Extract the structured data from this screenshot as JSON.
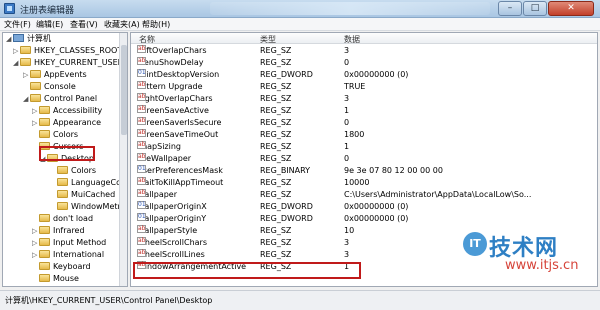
{
  "window": {
    "title": "注册表编辑器",
    "controls": {
      "minimize": "–",
      "maximize": "□",
      "close": "✕"
    }
  },
  "menubar": [
    "文件(F)",
    "编辑(E)",
    "查看(V)",
    "收藏夹(A)",
    "帮助(H)"
  ],
  "tree": {
    "root": "计算机",
    "items": [
      {
        "label": "HKEY_CLASSES_ROOT",
        "exp": "▷"
      },
      {
        "label": "HKEY_CURRENT_USER",
        "exp": "◢"
      },
      {
        "label": "AppEvents",
        "exp": "▷"
      },
      {
        "label": "Console",
        "exp": ""
      },
      {
        "label": "Control Panel",
        "exp": "◢"
      },
      {
        "label": "Accessibility",
        "exp": "▷"
      },
      {
        "label": "Appearance",
        "exp": "▷"
      },
      {
        "label": "Colors",
        "exp": ""
      },
      {
        "label": "Cursors",
        "exp": ""
      },
      {
        "label": "Desktop",
        "exp": "◢"
      },
      {
        "label": "Colors",
        "exp": ""
      },
      {
        "label": "LanguageCor",
        "exp": ""
      },
      {
        "label": "MuiCached",
        "exp": ""
      },
      {
        "label": "WindowMetr",
        "exp": ""
      },
      {
        "label": "don't load",
        "exp": ""
      },
      {
        "label": "Infrared",
        "exp": "▷"
      },
      {
        "label": "Input Method",
        "exp": "▷"
      },
      {
        "label": "International",
        "exp": "▷"
      },
      {
        "label": "Keyboard",
        "exp": ""
      },
      {
        "label": "Mouse",
        "exp": ""
      }
    ]
  },
  "list": {
    "columns": {
      "name": "名称",
      "type": "类型",
      "data": "数据"
    },
    "rows": [
      {
        "name": "LeftOverlapChars",
        "type": "REG_SZ",
        "data": "3",
        "icon": "sz"
      },
      {
        "name": "MenuShowDelay",
        "type": "REG_SZ",
        "data": "0",
        "icon": "sz"
      },
      {
        "name": "PaintDesktopVersion",
        "type": "REG_DWORD",
        "data": "0x00000000 (0)",
        "icon": "bin"
      },
      {
        "name": "Pattern Upgrade",
        "type": "REG_SZ",
        "data": "TRUE",
        "icon": "sz"
      },
      {
        "name": "RightOverlapChars",
        "type": "REG_SZ",
        "data": "3",
        "icon": "sz"
      },
      {
        "name": "ScreenSaveActive",
        "type": "REG_SZ",
        "data": "1",
        "icon": "sz"
      },
      {
        "name": "ScreenSaverIsSecure",
        "type": "REG_SZ",
        "data": "0",
        "icon": "sz"
      },
      {
        "name": "ScreenSaveTimeOut",
        "type": "REG_SZ",
        "data": "1800",
        "icon": "sz"
      },
      {
        "name": "SnapSizing",
        "type": "REG_SZ",
        "data": "1",
        "icon": "sz"
      },
      {
        "name": "TileWallpaper",
        "type": "REG_SZ",
        "data": "0",
        "icon": "sz"
      },
      {
        "name": "UserPreferencesMask",
        "type": "REG_BINARY",
        "data": "9e 3e 07 80 12 00 00 00",
        "icon": "bin"
      },
      {
        "name": "WaitToKillAppTimeout",
        "type": "REG_SZ",
        "data": "10000",
        "icon": "sz"
      },
      {
        "name": "Wallpaper",
        "type": "REG_SZ",
        "data": "C:\\Users\\Administrator\\AppData\\LocalLow\\So...",
        "icon": "sz"
      },
      {
        "name": "WallpaperOriginX",
        "type": "REG_DWORD",
        "data": "0x00000000 (0)",
        "icon": "bin"
      },
      {
        "name": "WallpaperOriginY",
        "type": "REG_DWORD",
        "data": "0x00000000 (0)",
        "icon": "bin"
      },
      {
        "name": "WallpaperStyle",
        "type": "REG_SZ",
        "data": "10",
        "icon": "sz"
      },
      {
        "name": "WheelScrollChars",
        "type": "REG_SZ",
        "data": "3",
        "icon": "sz"
      },
      {
        "name": "WheelScrollLines",
        "type": "REG_SZ",
        "data": "3",
        "icon": "sz"
      },
      {
        "name": "WindowArrangementActive",
        "type": "REG_SZ",
        "data": "1",
        "icon": "sz"
      }
    ]
  },
  "statusbar": {
    "path": "计算机\\HKEY_CURRENT_USER\\Control Panel\\Desktop"
  },
  "watermark": {
    "circle": "IT",
    "main": "技术网",
    "url": "www.itjs.cn"
  },
  "colors": {
    "highlight": "#c01a1a",
    "watermark_blue": "#2e7fc4",
    "watermark_red": "#d6443a"
  }
}
